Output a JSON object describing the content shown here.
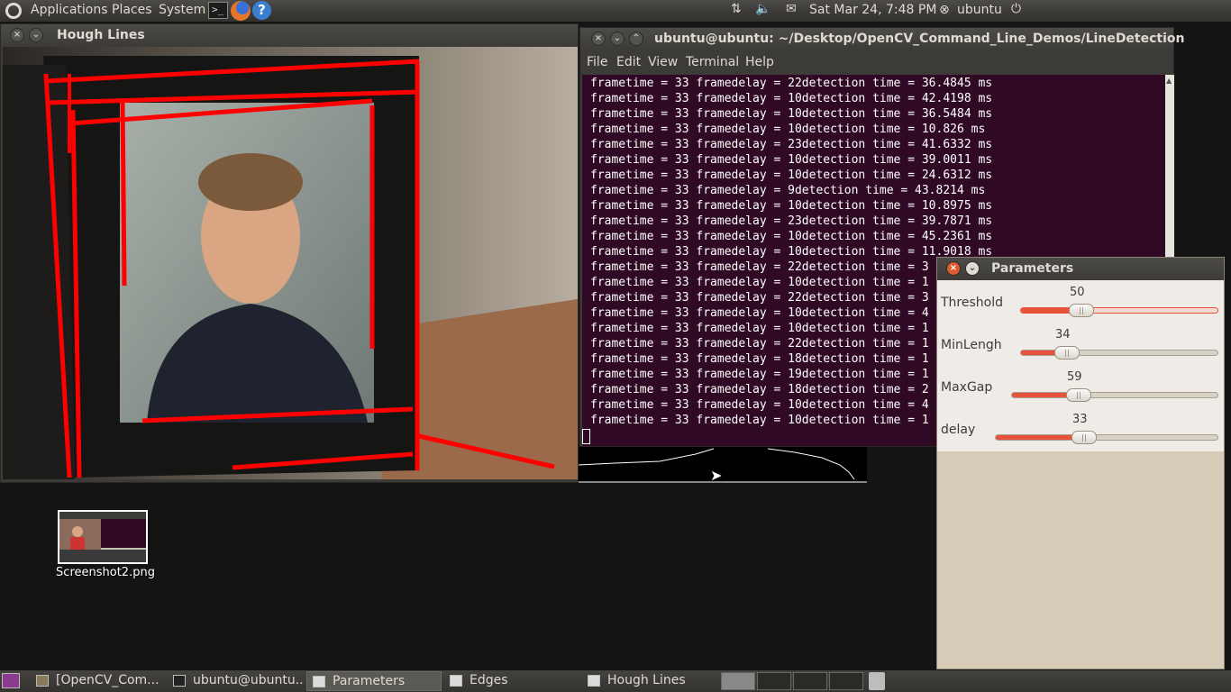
{
  "top_panel": {
    "menus": [
      "Applications",
      "Places",
      "System"
    ],
    "datetime": "Sat Mar 24,  7:48 PM",
    "user": "ubuntu"
  },
  "hough_window": {
    "title": "Hough Lines"
  },
  "terminal": {
    "title": "ubuntu@ubuntu: ~/Desktop/OpenCV_Command_Line_Demos/LineDetection",
    "menu": [
      "File",
      "Edit",
      "View",
      "Terminal",
      "Help"
    ],
    "lines": [
      "frametime = 33 framedelay = 22detection time = 36.4845 ms",
      "frametime = 33 framedelay = 10detection time = 42.4198 ms",
      "frametime = 33 framedelay = 10detection time = 36.5484 ms",
      "frametime = 33 framedelay = 10detection time = 10.826 ms",
      "frametime = 33 framedelay = 23detection time = 41.6332 ms",
      "frametime = 33 framedelay = 10detection time = 39.0011 ms",
      "frametime = 33 framedelay = 10detection time = 24.6312 ms",
      "frametime = 33 framedelay = 9detection time = 43.8214 ms",
      "frametime = 33 framedelay = 10detection time = 10.8975 ms",
      "frametime = 33 framedelay = 23detection time = 39.7871 ms",
      "frametime = 33 framedelay = 10detection time = 45.2361 ms",
      "frametime = 33 framedelay = 10detection time = 11.9018 ms",
      "frametime = 33 framedelay = 22detection time = 3",
      "frametime = 33 framedelay = 10detection time = 1",
      "frametime = 33 framedelay = 22detection time = 3",
      "frametime = 33 framedelay = 10detection time = 4",
      "frametime = 33 framedelay = 10detection time = 1",
      "frametime = 33 framedelay = 22detection time = 1",
      "frametime = 33 framedelay = 18detection time = 1",
      "frametime = 33 framedelay = 19detection time = 1",
      "frametime = 33 framedelay = 18detection time = 2",
      "frametime = 33 framedelay = 10detection time = 4",
      "frametime = 33 framedelay = 10detection time = 1"
    ]
  },
  "parameters": {
    "title": "Parameters",
    "sliders": [
      {
        "name": "Threshold",
        "value": "50",
        "fraction": 0.24
      },
      {
        "name": "MinLengh",
        "value": "34",
        "fraction": 0.17
      },
      {
        "name": "MaxGap",
        "value": "59",
        "fraction": 0.26
      },
      {
        "name": "delay",
        "value": "33",
        "fraction": 0.34
      }
    ]
  },
  "desktop_icon": {
    "label": "Screenshot2.png"
  },
  "taskbar": {
    "tasks": [
      "[OpenCV_Com...",
      "ubuntu@ubuntu...",
      "Parameters",
      "Edges",
      "Hough Lines"
    ]
  },
  "colors": {
    "terminal_bg": "#300a24",
    "slider_fill": "#e9523a",
    "hough_line": "#ff0000"
  }
}
